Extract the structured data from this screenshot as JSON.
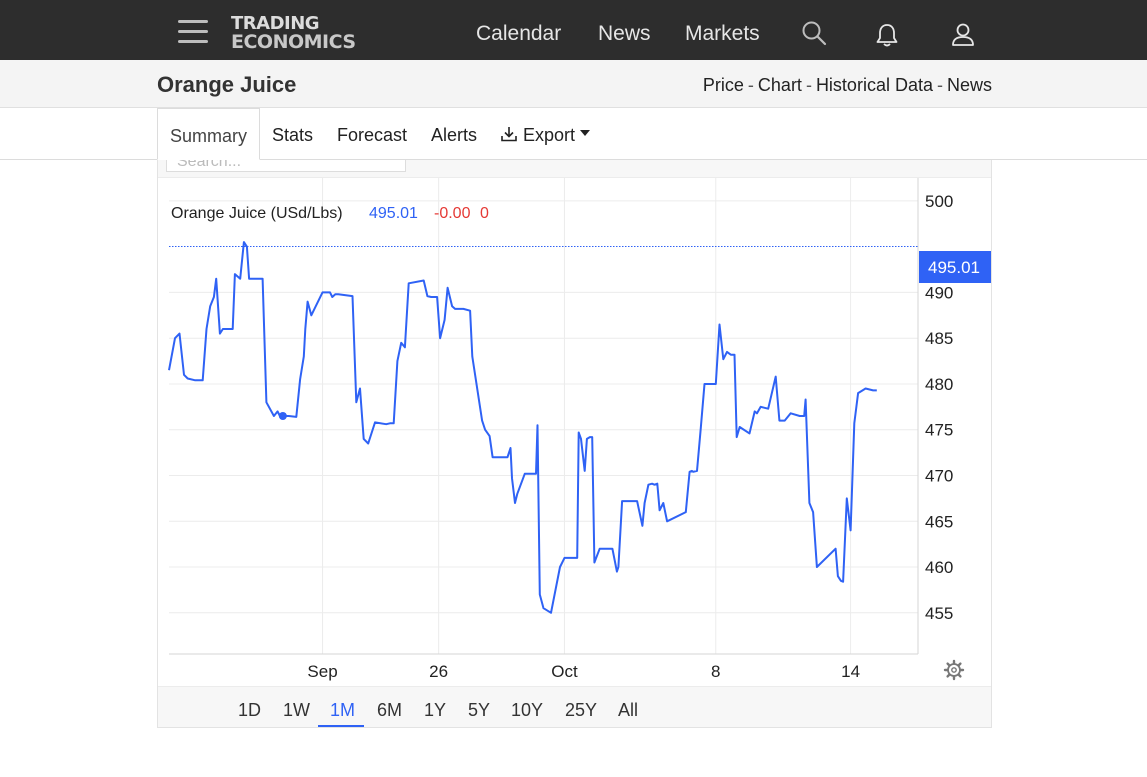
{
  "nav": {
    "logo_line1": "TRADING",
    "logo_line2": "ECONOMICS",
    "links": [
      "Calendar",
      "News",
      "Markets"
    ],
    "icons": [
      "search-icon",
      "bell-icon",
      "user-icon"
    ]
  },
  "page": {
    "title": "Orange Juice",
    "links": [
      "Price",
      "Chart",
      "Historical Data",
      "News"
    ],
    "separator": "-"
  },
  "tabs": {
    "items": [
      "Summary",
      "Stats",
      "Forecast",
      "Alerts"
    ],
    "active": "Summary",
    "export_label": "Export"
  },
  "search": {
    "placeholder": "Search..."
  },
  "chart_data": {
    "type": "line",
    "legend_label": "Orange Juice (USd/Lbs)",
    "last_value": "495.01",
    "change": "-0.00",
    "change_pct": "0",
    "price_tag": "495.01",
    "y_ticks": [
      500,
      490,
      485,
      480,
      475,
      470,
      465,
      460,
      455
    ],
    "ylim": [
      450.5,
      502.5
    ],
    "x_tick_labels": [
      "Sep",
      "26",
      "Oct",
      "8",
      "14"
    ],
    "x_tick_positions": [
      0.205,
      0.36,
      0.528,
      0.73,
      0.91
    ],
    "xlim": [
      0,
      1
    ],
    "grid": true,
    "line_color": "#2f62f5",
    "x": [
      0.0,
      0.008,
      0.014,
      0.02,
      0.025,
      0.035,
      0.045,
      0.05,
      0.055,
      0.06,
      0.063,
      0.068,
      0.072,
      0.085,
      0.088,
      0.095,
      0.1,
      0.104,
      0.107,
      0.125,
      0.13,
      0.14,
      0.145,
      0.148,
      0.16,
      0.17,
      0.175,
      0.18,
      0.182,
      0.185,
      0.19,
      0.205,
      0.21,
      0.215,
      0.218,
      0.222,
      0.226,
      0.245,
      0.25,
      0.255,
      0.26,
      0.266,
      0.275,
      0.29,
      0.29,
      0.295,
      0.3,
      0.305,
      0.31,
      0.315,
      0.32,
      0.34,
      0.345,
      0.35,
      0.358,
      0.362,
      0.368,
      0.372,
      0.378,
      0.382,
      0.393,
      0.402,
      0.405,
      0.418,
      0.422,
      0.428,
      0.432,
      0.45,
      0.452,
      0.456,
      0.458,
      0.462,
      0.465,
      0.475,
      0.49,
      0.492,
      0.495,
      0.5,
      0.51,
      0.522,
      0.528,
      0.545,
      0.547,
      0.55,
      0.555,
      0.558,
      0.562,
      0.565,
      0.568,
      0.575,
      0.592,
      0.598,
      0.6,
      0.605,
      0.61,
      0.625,
      0.632,
      0.635,
      0.64,
      0.645,
      0.648,
      0.652,
      0.655,
      0.66,
      0.665,
      0.69,
      0.695,
      0.698,
      0.7,
      0.705,
      0.71,
      0.715,
      0.73,
      0.735,
      0.74,
      0.745,
      0.75,
      0.755,
      0.758,
      0.762,
      0.775,
      0.782,
      0.785,
      0.79,
      0.795,
      0.8,
      0.81,
      0.815,
      0.822,
      0.83,
      0.842,
      0.848,
      0.85,
      0.855,
      0.86,
      0.865,
      0.89,
      0.893,
      0.897,
      0.9,
      0.905,
      0.91,
      0.915,
      0.92,
      0.93,
      0.94,
      0.945
    ]
  },
  "range_buttons": [
    "1D",
    "1W",
    "1M",
    "6M",
    "1Y",
    "5Y",
    "10Y",
    "25Y",
    "All"
  ],
  "range_active": "1M"
}
